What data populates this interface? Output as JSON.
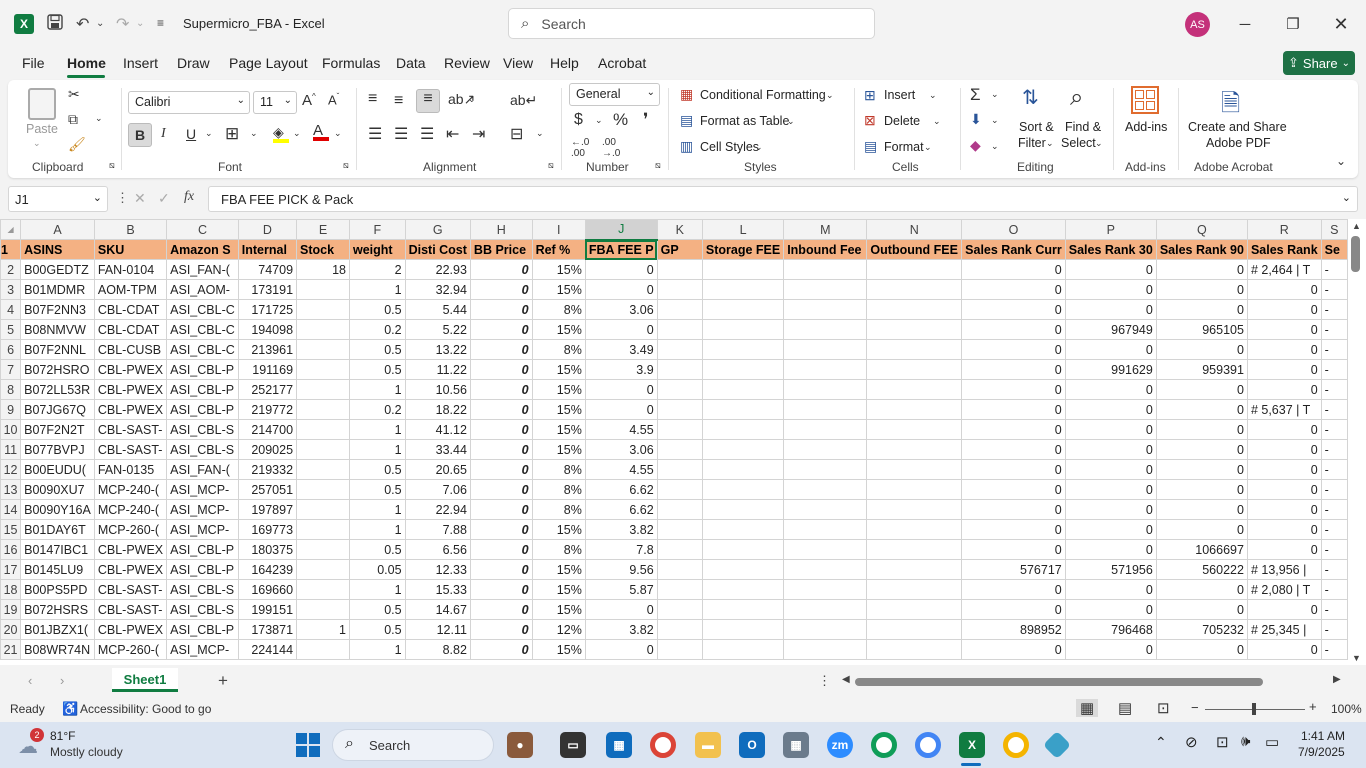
{
  "window": {
    "title": "Supermicro_FBA  -  Excel",
    "search_placeholder": "Search",
    "avatar_initials": "AS",
    "app_logo": "X"
  },
  "menu": {
    "items": [
      "File",
      "Home",
      "Insert",
      "Draw",
      "Page Layout",
      "Formulas",
      "Data",
      "Review",
      "View",
      "Help",
      "Acrobat"
    ],
    "share_label": "Share"
  },
  "ribbon": {
    "clipboard": {
      "label": "Clipboard",
      "paste": "Paste"
    },
    "font": {
      "label": "Font",
      "name": "Calibri",
      "size": "11"
    },
    "alignment": {
      "label": "Alignment"
    },
    "number": {
      "label": "Number",
      "format": "General"
    },
    "styles": {
      "label": "Styles",
      "conditional": "Conditional Formatting",
      "table": "Format as Table",
      "cell_styles": "Cell Styles"
    },
    "cells": {
      "label": "Cells",
      "insert": "Insert",
      "delete": "Delete",
      "format": "Format"
    },
    "editing": {
      "label": "Editing",
      "sort1": "Sort &",
      "sort2": "Filter",
      "find1": "Find &",
      "find2": "Select"
    },
    "addins": {
      "label": "Add-ins",
      "button": "Add-ins"
    },
    "acrobat": {
      "label": "Adobe Acrobat",
      "line1": "Create and Share",
      "line2": "Adobe PDF"
    }
  },
  "formula_bar": {
    "name_box": "J1",
    "formula": "FBA FEE PICK & Pack"
  },
  "columns": [
    "A",
    "B",
    "C",
    "D",
    "E",
    "F",
    "G",
    "H",
    "I",
    "J",
    "K",
    "L",
    "M",
    "N",
    "O",
    "P",
    "Q",
    "R",
    "S"
  ],
  "headers": [
    "ASINS",
    "SKU",
    "Amazon S",
    "Internal",
    "Stock",
    "weight",
    "Disti Cost",
    "BB Price",
    "Ref %",
    "FBA FEE P",
    "GP",
    "Storage FEE",
    "Inbound Fee",
    "Outbound FEE",
    "Sales Rank Curr",
    "Sales Rank 30",
    "Sales Rank 90",
    "Sales Rank",
    "Se"
  ],
  "rows": [
    [
      "2",
      "B00GEDTZ",
      "FAN-0104",
      "ASI_FAN-(",
      "74709",
      "18",
      "2",
      "22.93",
      "0",
      "15%",
      "0",
      "",
      "",
      "",
      "",
      "0",
      "0",
      "0",
      "# 2,464  |  T",
      "-"
    ],
    [
      "3",
      "B01MDMR",
      "AOM-TPM",
      "ASI_AOM-",
      "173191",
      "",
      "1",
      "32.94",
      "0",
      "15%",
      "0",
      "",
      "",
      "",
      "",
      "0",
      "0",
      "0",
      "0",
      "-"
    ],
    [
      "4",
      "B07F2NN3",
      "CBL-CDAT",
      "ASI_CBL-C",
      "171725",
      "",
      "0.5",
      "5.44",
      "0",
      "8%",
      "3.06",
      "",
      "",
      "",
      "",
      "0",
      "0",
      "0",
      "0",
      "-"
    ],
    [
      "5",
      "B08NMVW",
      "CBL-CDAT",
      "ASI_CBL-C",
      "194098",
      "",
      "0.2",
      "5.22",
      "0",
      "15%",
      "0",
      "",
      "",
      "",
      "",
      "0",
      "967949",
      "965105",
      "0",
      "-"
    ],
    [
      "6",
      "B07F2NNL",
      "CBL-CUSB",
      "ASI_CBL-C",
      "213961",
      "",
      "0.5",
      "13.22",
      "0",
      "8%",
      "3.49",
      "",
      "",
      "",
      "",
      "0",
      "0",
      "0",
      "0",
      "-"
    ],
    [
      "7",
      "B072HSRO",
      "CBL-PWEX",
      "ASI_CBL-P",
      "191169",
      "",
      "0.5",
      "11.22",
      "0",
      "15%",
      "3.9",
      "",
      "",
      "",
      "",
      "0",
      "991629",
      "959391",
      "0",
      "-"
    ],
    [
      "8",
      "B072LL53R",
      "CBL-PWEX",
      "ASI_CBL-P",
      "252177",
      "",
      "1",
      "10.56",
      "0",
      "15%",
      "0",
      "",
      "",
      "",
      "",
      "0",
      "0",
      "0",
      "0",
      "-"
    ],
    [
      "9",
      "B07JG67Q",
      "CBL-PWEX",
      "ASI_CBL-P",
      "219772",
      "",
      "0.2",
      "18.22",
      "0",
      "15%",
      "0",
      "",
      "",
      "",
      "",
      "0",
      "0",
      "0",
      "# 5,637  |  T",
      "-"
    ],
    [
      "10",
      "B07F2N2T",
      "CBL-SAST-",
      "ASI_CBL-S",
      "214700",
      "",
      "1",
      "41.12",
      "0",
      "15%",
      "4.55",
      "",
      "",
      "",
      "",
      "0",
      "0",
      "0",
      "0",
      "-"
    ],
    [
      "11",
      "B077BVPJ",
      "CBL-SAST-",
      "ASI_CBL-S",
      "209025",
      "",
      "1",
      "33.44",
      "0",
      "15%",
      "3.06",
      "",
      "",
      "",
      "",
      "0",
      "0",
      "0",
      "0",
      "-"
    ],
    [
      "12",
      "B00EUDU(",
      "FAN-0135",
      "ASI_FAN-(",
      "219332",
      "",
      "0.5",
      "20.65",
      "0",
      "8%",
      "4.55",
      "",
      "",
      "",
      "",
      "0",
      "0",
      "0",
      "0",
      "-"
    ],
    [
      "13",
      "B0090XU7",
      "MCP-240-(",
      "ASI_MCP-",
      "257051",
      "",
      "0.5",
      "7.06",
      "0",
      "8%",
      "6.62",
      "",
      "",
      "",
      "",
      "0",
      "0",
      "0",
      "0",
      "-"
    ],
    [
      "14",
      "B0090Y16A",
      "MCP-240-(",
      "ASI_MCP-",
      "197897",
      "",
      "1",
      "22.94",
      "0",
      "8%",
      "6.62",
      "",
      "",
      "",
      "",
      "0",
      "0",
      "0",
      "0",
      "-"
    ],
    [
      "15",
      "B01DAY6T",
      "MCP-260-(",
      "ASI_MCP-",
      "169773",
      "",
      "1",
      "7.88",
      "0",
      "15%",
      "3.82",
      "",
      "",
      "",
      "",
      "0",
      "0",
      "0",
      "0",
      "-"
    ],
    [
      "16",
      "B0147IBC1",
      "CBL-PWEX",
      "ASI_CBL-P",
      "180375",
      "",
      "0.5",
      "6.56",
      "0",
      "8%",
      "7.8",
      "",
      "",
      "",
      "",
      "0",
      "0",
      "1066697",
      "0",
      "-"
    ],
    [
      "17",
      "B0145LU9",
      "CBL-PWEX",
      "ASI_CBL-P",
      "164239",
      "",
      "0.05",
      "12.33",
      "0",
      "15%",
      "9.56",
      "",
      "",
      "",
      "",
      "576717",
      "571956",
      "560222",
      "# 13,956  |",
      "-"
    ],
    [
      "18",
      "B00PS5PD",
      "CBL-SAST-",
      "ASI_CBL-S",
      "169660",
      "",
      "1",
      "15.33",
      "0",
      "15%",
      "5.87",
      "",
      "",
      "",
      "",
      "0",
      "0",
      "0",
      "# 2,080  |  T",
      "-"
    ],
    [
      "19",
      "B072HSRS",
      "CBL-SAST-",
      "ASI_CBL-S",
      "199151",
      "",
      "0.5",
      "14.67",
      "0",
      "15%",
      "0",
      "",
      "",
      "",
      "",
      "0",
      "0",
      "0",
      "0",
      "-"
    ],
    [
      "20",
      "B01JBZX1(",
      "CBL-PWEX",
      "ASI_CBL-P",
      "173871",
      "1",
      "0.5",
      "12.11",
      "0",
      "12%",
      "3.82",
      "",
      "",
      "",
      "",
      "898952",
      "796468",
      "705232",
      "# 25,345  |",
      "-"
    ],
    [
      "21",
      "B08WR74N",
      "MCP-260-(",
      "ASI_MCP-",
      "224144",
      "",
      "1",
      "8.82",
      "0",
      "15%",
      "0",
      "",
      "",
      "",
      "",
      "0",
      "0",
      "0",
      "0",
      "-"
    ]
  ],
  "sheet_tab": "Sheet1",
  "status": {
    "ready": "Ready",
    "accessibility": "Accessibility: Good to go",
    "zoom": "100%"
  },
  "taskbar": {
    "weather_temp": "81°F",
    "weather_desc": "Mostly cloudy",
    "weather_badge": "2",
    "search": "Search",
    "time": "1:41 AM",
    "date": "7/9/2025"
  }
}
